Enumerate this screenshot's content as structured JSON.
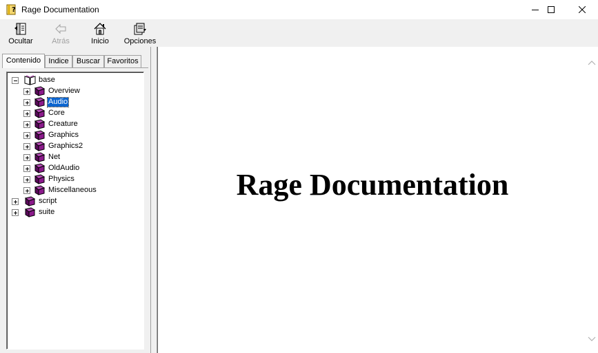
{
  "window": {
    "title": "Rage Documentation",
    "controls": [
      "minimize",
      "maximize",
      "close"
    ]
  },
  "toolbar": {
    "buttons": [
      {
        "label": "Ocultar",
        "icon": "hide-pane-icon",
        "enabled": true
      },
      {
        "label": "Atrás",
        "icon": "back-arrow-icon",
        "enabled": false
      },
      {
        "label": "Inicio",
        "icon": "home-icon",
        "enabled": true
      },
      {
        "label": "Opciones",
        "icon": "options-icon",
        "enabled": true
      }
    ]
  },
  "tabs": [
    {
      "label": "Contenido",
      "active": true
    },
    {
      "label": "Indice",
      "active": false
    },
    {
      "label": "Buscar",
      "active": false
    },
    {
      "label": "Favoritos",
      "active": false
    }
  ],
  "tree": {
    "root": {
      "label": "base",
      "expanded": true,
      "icon": "open-book-icon"
    },
    "children": [
      {
        "label": "Overview"
      },
      {
        "label": "Audio",
        "selected": true
      },
      {
        "label": "Core"
      },
      {
        "label": "Creature"
      },
      {
        "label": "Graphics"
      },
      {
        "label": "Graphics2"
      },
      {
        "label": "Net"
      },
      {
        "label": "OldAudio"
      },
      {
        "label": "Physics"
      },
      {
        "label": "Miscellaneous"
      }
    ],
    "siblings": [
      {
        "label": "script"
      },
      {
        "label": "suite"
      }
    ]
  },
  "content": {
    "heading": "Rage Documentation"
  },
  "colors": {
    "book": "#8b1a8b",
    "selection": "#0a64cf"
  }
}
